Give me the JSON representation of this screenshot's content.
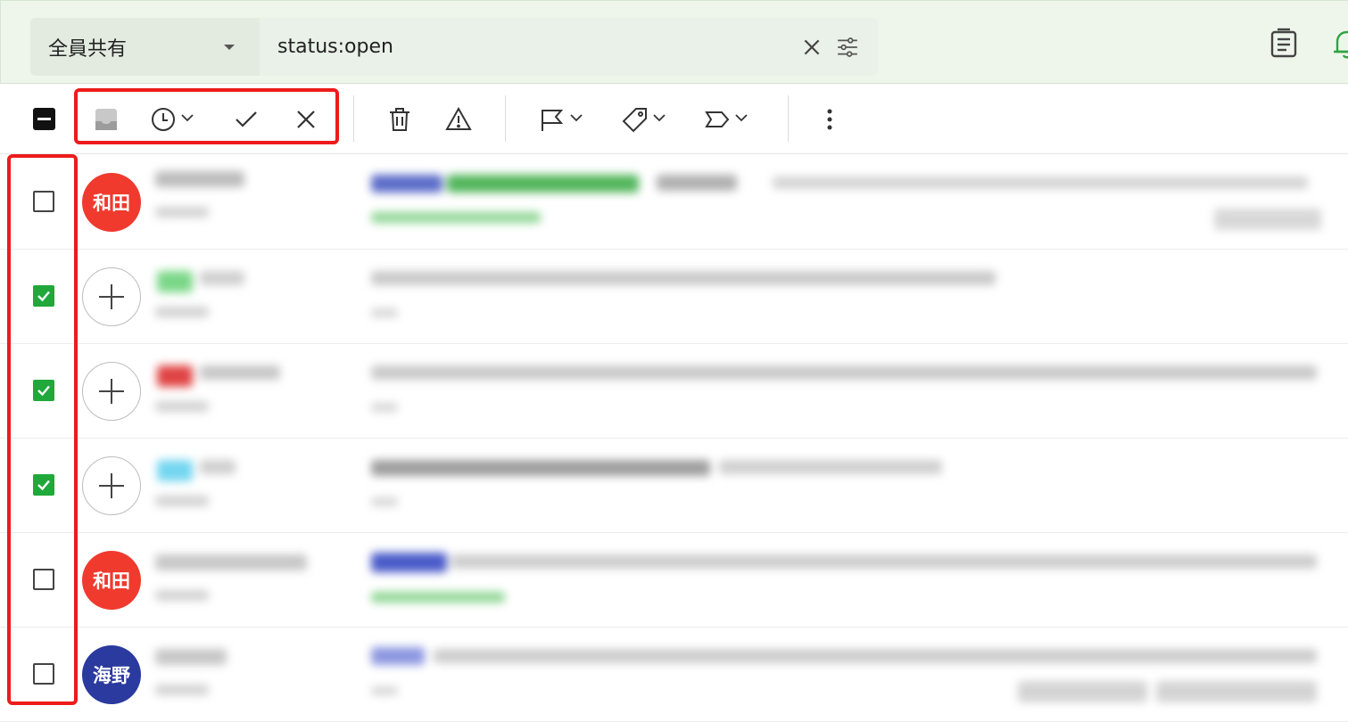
{
  "header": {
    "scope_label": "全員共有",
    "query_value": "status:open",
    "icons": [
      "close-icon",
      "filter-sliders-icon",
      "clipboard-list-icon",
      "bell-icon"
    ]
  },
  "toolbar": {
    "icons": [
      "select-all-indeterminate-icon",
      "inbox-icon",
      "snooze-clock-icon",
      "check-icon",
      "close-icon",
      "trash-icon",
      "warning-icon",
      "flag-icon",
      "tag-icon",
      "label-icon",
      "more-vertical-icon"
    ]
  },
  "rows": [
    {
      "checked": false,
      "avatar_type": "initials",
      "avatar_text": "和田",
      "avatar_color": "#f03a2e"
    },
    {
      "checked": true,
      "avatar_type": "add",
      "avatar_text": "",
      "avatar_color": "#ffffff"
    },
    {
      "checked": true,
      "avatar_type": "add",
      "avatar_text": "",
      "avatar_color": "#ffffff"
    },
    {
      "checked": true,
      "avatar_type": "add",
      "avatar_text": "",
      "avatar_color": "#ffffff"
    },
    {
      "checked": false,
      "avatar_type": "initials",
      "avatar_text": "和田",
      "avatar_color": "#f03a2e"
    },
    {
      "checked": false,
      "avatar_type": "initials",
      "avatar_text": "海野",
      "avatar_color": "#2b3a9e"
    }
  ],
  "colors": {
    "accent_green": "#20a83a",
    "highlight_red": "#ee1b1b",
    "header_bg": "#eef6ec"
  }
}
